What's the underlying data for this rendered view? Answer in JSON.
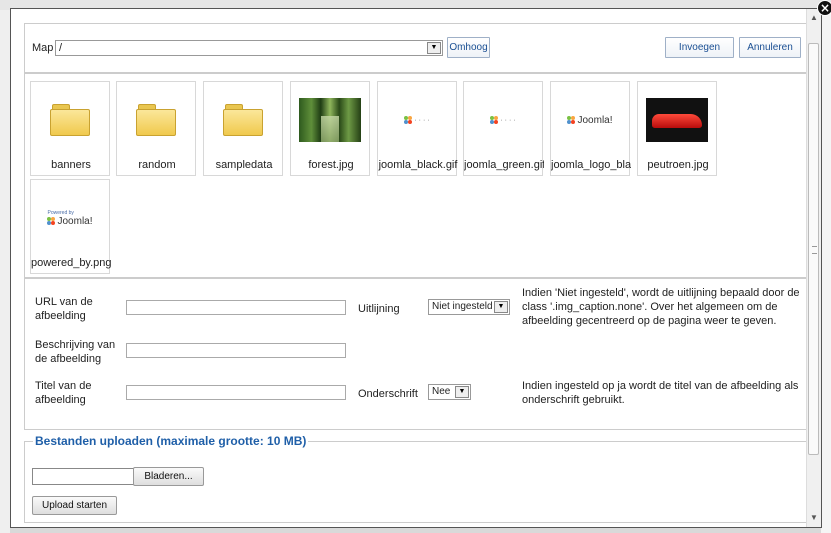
{
  "toolbar": {
    "map_label": "Map",
    "path_value": "/",
    "up_button": "Omhoog",
    "insert_button": "Invoegen",
    "cancel_button": "Annuleren"
  },
  "files": [
    {
      "name": "banners",
      "type": "folder"
    },
    {
      "name": "random",
      "type": "folder"
    },
    {
      "name": "sampledata",
      "type": "folder"
    },
    {
      "name": "forest.jpg",
      "type": "image-forest"
    },
    {
      "name": "joomla_black.gif",
      "type": "image-joomla-small"
    },
    {
      "name": "joomla_green.gif",
      "type": "image-joomla-small"
    },
    {
      "name": "joomla_logo_blac",
      "type": "image-joomla-logo"
    },
    {
      "name": "peutroen.jpg",
      "type": "image-car"
    },
    {
      "name": "powered_by.png",
      "type": "image-powered"
    }
  ],
  "logo": {
    "joomla_text": "Joomla!",
    "powered_by_text": "Powered by"
  },
  "form": {
    "url_label": "URL van de afbeelding",
    "url_value": "",
    "alignment_label": "Uitlijning",
    "alignment_value": "Niet ingesteld",
    "alignment_help": "Indien 'Niet ingesteld', wordt de uitlijning bepaald door de class '.img_caption.none'. Over het algemeen om de afbeelding gecentreerd op de pagina weer te geven.",
    "description_label": "Beschrijving van de afbeelding",
    "description_value": "",
    "title_label": "Titel van de afbeelding",
    "title_value": "",
    "caption_label": "Onderschrift",
    "caption_value": "Nee",
    "caption_help": "Indien ingesteld op ja wordt de titel van de afbeelding als onderschrift gebruikt."
  },
  "upload": {
    "title": "Bestanden uploaden (maximale grootte: 10 MB)",
    "browse_button": "Bladeren...",
    "start_button": "Upload starten"
  },
  "colors": {
    "link_blue": "#1f5fa8",
    "border": "#cccccc"
  }
}
